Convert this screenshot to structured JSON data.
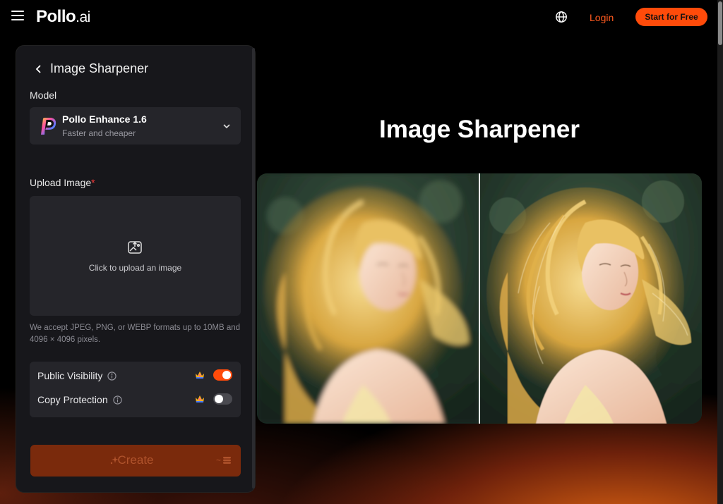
{
  "header": {
    "logo_main": "Pollo",
    "logo_suffix": ".ai",
    "login_label": "Login",
    "start_label": "Start for Free",
    "accent_color": "#ff4b0a"
  },
  "panel": {
    "title": "Image Sharpener",
    "model_label": "Model",
    "model": {
      "name": "Pollo Enhance 1.6",
      "subtitle": "Faster and cheaper",
      "icon": "pollo-p-logo"
    },
    "upload_label": "Upload Image",
    "required_mark": "*",
    "upload_prompt": "Click to upload an image",
    "hint": "We accept JPEG, PNG, or WEBP formats up to 10MB and 4096 × 4096 pixels.",
    "options": [
      {
        "label": "Public Visibility",
        "enabled": true
      },
      {
        "label": "Copy Protection",
        "enabled": false
      }
    ],
    "create_label": "Create",
    "create_cost": "~"
  },
  "main": {
    "title": "Image Sharpener",
    "comparison": {
      "left": "blurred-portrait",
      "right": "sharpened-portrait"
    }
  }
}
